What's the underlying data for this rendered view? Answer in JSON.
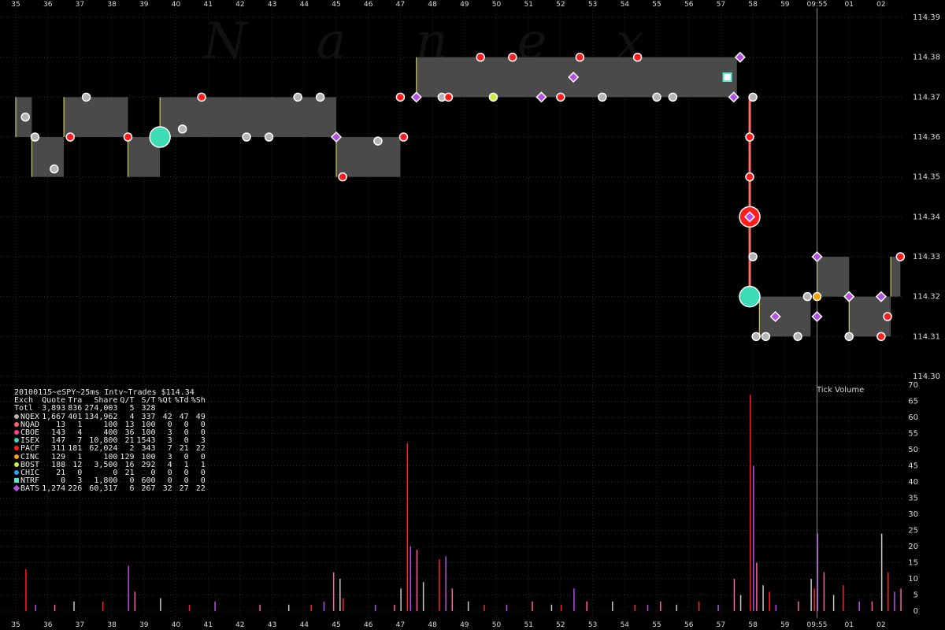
{
  "chart_data": [
    {
      "type": "scatter",
      "title": "20100115~eSPY~25ms Intv~Trades $114.34",
      "watermark": "N a n e x",
      "x_ticks": [
        "35",
        "36",
        "37",
        "38",
        "39",
        "40",
        "41",
        "42",
        "43",
        "44",
        "45",
        "46",
        "47",
        "48",
        "49",
        "50",
        "51",
        "52",
        "53",
        "54",
        "55",
        "56",
        "57",
        "58",
        "59",
        "09:55",
        "01",
        "02"
      ],
      "y_ticks": [
        114.39,
        114.38,
        114.37,
        114.36,
        114.35,
        114.34,
        114.33,
        114.32,
        114.31,
        114.3
      ],
      "ylim": [
        114.3,
        114.39
      ],
      "current_marker": "09:55",
      "nbbo_bands": [
        {
          "x0": "35",
          "x1": "35.5",
          "low": 114.36,
          "high": 114.37
        },
        {
          "x0": "35.5",
          "x1": "36.5",
          "low": 114.35,
          "high": 114.36
        },
        {
          "x0": "36.5",
          "x1": "38.5",
          "low": 114.36,
          "high": 114.37
        },
        {
          "x0": "38.5",
          "x1": "39.5",
          "low": 114.35,
          "high": 114.36
        },
        {
          "x0": "39.5",
          "x1": "45",
          "low": 114.36,
          "high": 114.37
        },
        {
          "x0": "45",
          "x1": "47",
          "low": 114.35,
          "high": 114.36
        },
        {
          "x0": "47.5",
          "x1": "57.5",
          "low": 114.37,
          "high": 114.38
        },
        {
          "x0": "58.2",
          "x1": "59.8",
          "low": 114.31,
          "high": 114.32
        },
        {
          "x0": "09:55",
          "x1": "01",
          "low": 114.32,
          "high": 114.33
        },
        {
          "x0": "01",
          "x1": "02.3",
          "low": 114.31,
          "high": 114.32
        },
        {
          "x0": "02.3",
          "x1": "02.6",
          "low": 114.32,
          "high": 114.33
        }
      ],
      "trades": [
        {
          "x": "35.3",
          "y": 114.365,
          "exch": "NQEX"
        },
        {
          "x": "35.6",
          "y": 114.36,
          "exch": "NQEX"
        },
        {
          "x": "36.2",
          "y": 114.352,
          "exch": "NQEX"
        },
        {
          "x": "36.7",
          "y": 114.36,
          "exch": "PACF"
        },
        {
          "x": "37.2",
          "y": 114.37,
          "exch": "NQEX"
        },
        {
          "x": "38.5",
          "y": 114.36,
          "exch": "PACF"
        },
        {
          "x": "39.5",
          "y": 114.36,
          "exch": "ISEX"
        },
        {
          "x": "40.2",
          "y": 114.362,
          "exch": "NQEX"
        },
        {
          "x": "40.8",
          "y": 114.37,
          "exch": "PACF"
        },
        {
          "x": "42.2",
          "y": 114.36,
          "exch": "NQEX"
        },
        {
          "x": "42.9",
          "y": 114.36,
          "exch": "NQEX"
        },
        {
          "x": "43.8",
          "y": 114.37,
          "exch": "NQEX"
        },
        {
          "x": "44.5",
          "y": 114.37,
          "exch": "NQEX"
        },
        {
          "x": "45",
          "y": 114.36,
          "exch": "BATS"
        },
        {
          "x": "45.2",
          "y": 114.35,
          "exch": "PACF"
        },
        {
          "x": "46.3",
          "y": 114.359,
          "exch": "NQEX"
        },
        {
          "x": "47",
          "y": 114.37,
          "exch": "PACF"
        },
        {
          "x": "47.1",
          "y": 114.36,
          "exch": "PACF"
        },
        {
          "x": "47.5",
          "y": 114.37,
          "exch": "BATS"
        },
        {
          "x": "48.3",
          "y": 114.37,
          "exch": "NQEX"
        },
        {
          "x": "48.5",
          "y": 114.37,
          "exch": "PACF"
        },
        {
          "x": "49.5",
          "y": 114.38,
          "exch": "PACF"
        },
        {
          "x": "49.9",
          "y": 114.37,
          "exch": "BOST"
        },
        {
          "x": "50.5",
          "y": 114.38,
          "exch": "PACF"
        },
        {
          "x": "51.4",
          "y": 114.37,
          "exch": "BATS"
        },
        {
          "x": "52",
          "y": 114.37,
          "exch": "PACF"
        },
        {
          "x": "52.4",
          "y": 114.375,
          "exch": "BATS"
        },
        {
          "x": "52.6",
          "y": 114.38,
          "exch": "PACF"
        },
        {
          "x": "53.3",
          "y": 114.37,
          "exch": "NQEX"
        },
        {
          "x": "54.4",
          "y": 114.38,
          "exch": "PACF"
        },
        {
          "x": "55",
          "y": 114.37,
          "exch": "NQEX"
        },
        {
          "x": "55.5",
          "y": 114.37,
          "exch": "NQEX"
        },
        {
          "x": "57.2",
          "y": 114.375,
          "exch": "NTRF"
        },
        {
          "x": "57.4",
          "y": 114.37,
          "exch": "BATS"
        },
        {
          "x": "57.6",
          "y": 114.38,
          "exch": "BATS"
        },
        {
          "x": "58",
          "y": 114.37,
          "exch": "NQEX"
        },
        {
          "x": "57.9",
          "y": 114.36,
          "exch": "PACF"
        },
        {
          "x": "57.9",
          "y": 114.35,
          "exch": "PACF"
        },
        {
          "x": "57.9",
          "y": 114.34,
          "exch": "PACF"
        },
        {
          "x": "57.9",
          "y": 114.34,
          "exch": "BATS"
        },
        {
          "x": "58",
          "y": 114.33,
          "exch": "NQEX"
        },
        {
          "x": "57.9",
          "y": 114.32,
          "exch": "ISEX"
        },
        {
          "x": "58.1",
          "y": 114.31,
          "exch": "NQEX"
        },
        {
          "x": "58.4",
          "y": 114.31,
          "exch": "NQEX"
        },
        {
          "x": "58.7",
          "y": 114.315,
          "exch": "BATS"
        },
        {
          "x": "59.4",
          "y": 114.31,
          "exch": "NQEX"
        },
        {
          "x": "59.7",
          "y": 114.32,
          "exch": "NQEX"
        },
        {
          "x": "09:55",
          "y": 114.32,
          "exch": "CINC"
        },
        {
          "x": "09:55",
          "y": 114.33,
          "exch": "BATS"
        },
        {
          "x": "09:55",
          "y": 114.315,
          "exch": "BATS"
        },
        {
          "x": "01",
          "y": 114.32,
          "exch": "BATS"
        },
        {
          "x": "01",
          "y": 114.31,
          "exch": "NQEX"
        },
        {
          "x": "02",
          "y": 114.32,
          "exch": "BATS"
        },
        {
          "x": "02",
          "y": 114.31,
          "exch": "PACF"
        },
        {
          "x": "02.2",
          "y": 114.315,
          "exch": "PACF"
        },
        {
          "x": "02.6",
          "y": 114.33,
          "exch": "PACF"
        }
      ]
    },
    {
      "type": "bar",
      "title": "Tick Volume",
      "ylim": [
        0,
        70
      ],
      "y_ticks": [
        0,
        5,
        10,
        15,
        20,
        25,
        30,
        35,
        40,
        45,
        50,
        55,
        60,
        65,
        70
      ],
      "bars": [
        {
          "x": "35.3",
          "v": 13
        },
        {
          "x": "35.6",
          "v": 2
        },
        {
          "x": "36.2",
          "v": 2
        },
        {
          "x": "36.8",
          "v": 3
        },
        {
          "x": "37.7",
          "v": 3
        },
        {
          "x": "38.5",
          "v": 14
        },
        {
          "x": "38.7",
          "v": 6
        },
        {
          "x": "39.5",
          "v": 4
        },
        {
          "x": "40.4",
          "v": 2
        },
        {
          "x": "41.2",
          "v": 3
        },
        {
          "x": "42.6",
          "v": 2
        },
        {
          "x": "43.5",
          "v": 2
        },
        {
          "x": "44.2",
          "v": 2
        },
        {
          "x": "44.6",
          "v": 3
        },
        {
          "x": "44.9",
          "v": 12
        },
        {
          "x": "45.1",
          "v": 10
        },
        {
          "x": "45.2",
          "v": 4
        },
        {
          "x": "46.2",
          "v": 2
        },
        {
          "x": "46.8",
          "v": 2
        },
        {
          "x": "47",
          "v": 7
        },
        {
          "x": "47.2",
          "v": 52
        },
        {
          "x": "47.3",
          "v": 20
        },
        {
          "x": "47.5",
          "v": 19
        },
        {
          "x": "47.7",
          "v": 9
        },
        {
          "x": "48.2",
          "v": 16
        },
        {
          "x": "48.4",
          "v": 17
        },
        {
          "x": "48.6",
          "v": 7
        },
        {
          "x": "49.1",
          "v": 3
        },
        {
          "x": "49.6",
          "v": 2
        },
        {
          "x": "50.3",
          "v": 2
        },
        {
          "x": "51.1",
          "v": 3
        },
        {
          "x": "51.7",
          "v": 2
        },
        {
          "x": "52",
          "v": 2
        },
        {
          "x": "52.4",
          "v": 7
        },
        {
          "x": "52.8",
          "v": 3
        },
        {
          "x": "53.6",
          "v": 3
        },
        {
          "x": "54.3",
          "v": 2
        },
        {
          "x": "54.7",
          "v": 2
        },
        {
          "x": "55.1",
          "v": 3
        },
        {
          "x": "55.6",
          "v": 2
        },
        {
          "x": "56.3",
          "v": 3
        },
        {
          "x": "56.9",
          "v": 2
        },
        {
          "x": "57.4",
          "v": 10
        },
        {
          "x": "57.6",
          "v": 5
        },
        {
          "x": "57.9",
          "v": 67
        },
        {
          "x": "58",
          "v": 45
        },
        {
          "x": "58.1",
          "v": 15
        },
        {
          "x": "58.3",
          "v": 8
        },
        {
          "x": "58.5",
          "v": 6
        },
        {
          "x": "58.7",
          "v": 2
        },
        {
          "x": "59.4",
          "v": 3
        },
        {
          "x": "59.8",
          "v": 10
        },
        {
          "x": "59.9",
          "v": 7
        },
        {
          "x": "09:55",
          "v": 24
        },
        {
          "x": "00.2",
          "v": 12
        },
        {
          "x": "00.5",
          "v": 5
        },
        {
          "x": "00.8",
          "v": 8
        },
        {
          "x": "01.3",
          "v": 3
        },
        {
          "x": "01.7",
          "v": 3
        },
        {
          "x": "02",
          "v": 24
        },
        {
          "x": "02.2",
          "v": 12
        },
        {
          "x": "02.4",
          "v": 6
        },
        {
          "x": "02.6",
          "v": 7
        }
      ]
    }
  ],
  "stats": {
    "header": [
      "Exch",
      "Quote",
      "Tra",
      "Share",
      "Q/T",
      "S/T",
      "%Qt",
      "%Td",
      "%Sh"
    ],
    "rows": [
      {
        "name": "Totl",
        "quote": "3,893",
        "tra": "836",
        "share": "274,003",
        "qt": "5",
        "st": "328",
        "pqt": "",
        "ptd": "",
        "psh": "",
        "color": "",
        "shape": "none"
      },
      {
        "name": "NQEX",
        "quote": "1,667",
        "tra": "401",
        "share": "134,962",
        "qt": "4",
        "st": "337",
        "pqt": "42",
        "ptd": "47",
        "psh": "49",
        "color": "#b4b4b4",
        "shape": "circle"
      },
      {
        "name": "NQAD",
        "quote": "13",
        "tra": "1",
        "share": "100",
        "qt": "13",
        "st": "100",
        "pqt": "0",
        "ptd": "0",
        "psh": "0",
        "color": "#ff6464",
        "shape": "circle"
      },
      {
        "name": "CBOE",
        "quote": "143",
        "tra": "4",
        "share": "400",
        "qt": "36",
        "st": "100",
        "pqt": "3",
        "ptd": "0",
        "psh": "0",
        "color": "#ff3c96",
        "shape": "circle"
      },
      {
        "name": "ISEX",
        "quote": "147",
        "tra": "7",
        "share": "10,800",
        "qt": "21",
        "st": "1543",
        "pqt": "3",
        "ptd": "0",
        "psh": "3",
        "color": "#3cdcb4",
        "shape": "circle"
      },
      {
        "name": "PACF",
        "quote": "311",
        "tra": "181",
        "share": "62,024",
        "qt": "2",
        "st": "343",
        "pqt": "7",
        "ptd": "21",
        "psh": "22",
        "color": "#ff1e1e",
        "shape": "circle"
      },
      {
        "name": "CINC",
        "quote": "129",
        "tra": "1",
        "share": "100",
        "qt": "129",
        "st": "100",
        "pqt": "3",
        "ptd": "0",
        "psh": "0",
        "color": "#ffa000",
        "shape": "circle"
      },
      {
        "name": "BOST",
        "quote": "188",
        "tra": "12",
        "share": "3,500",
        "qt": "16",
        "st": "292",
        "pqt": "4",
        "ptd": "1",
        "psh": "1",
        "color": "#c8f03c",
        "shape": "circle"
      },
      {
        "name": "CHIC",
        "quote": "21",
        "tra": "0",
        "share": "0",
        "qt": "21",
        "st": "0",
        "pqt": "0",
        "ptd": "0",
        "psh": "0",
        "color": "#28a0ff",
        "shape": "circle"
      },
      {
        "name": "NTRF",
        "quote": "0",
        "tra": "3",
        "share": "1,800",
        "qt": "0",
        "st": "600",
        "pqt": "0",
        "ptd": "0",
        "psh": "0",
        "color": "#5ae6c8",
        "shape": "square"
      },
      {
        "name": "BATS",
        "quote": "1,274",
        "tra": "226",
        "share": "60,317",
        "qt": "6",
        "st": "267",
        "pqt": "32",
        "ptd": "27",
        "psh": "22",
        "color": "#b450e6",
        "shape": "diamond"
      }
    ]
  }
}
